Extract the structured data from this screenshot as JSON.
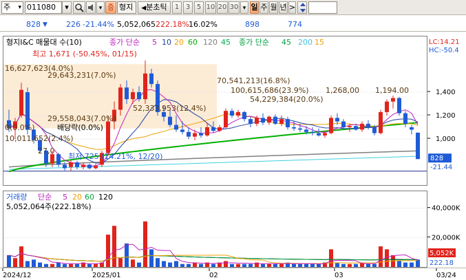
{
  "toolbar": {
    "market_label": "주",
    "stock_code": "011080",
    "mode_label": "증",
    "name_label": "형지",
    "unit_label": "분초틱",
    "periods": [
      "1",
      "3",
      "5",
      "10",
      "20",
      "30"
    ],
    "dropdown_label": "▾",
    "day_label": "일",
    "week_label": "주",
    "month_label": "월",
    "year_label": "년",
    "next_label": ">"
  },
  "infobar": {
    "price": "828",
    "change": "226",
    "change_pct": "-21.44%",
    "volume": "5,052,065",
    "volume_pct": "222.18%",
    "turnover": "16.02%",
    "val1": "898",
    "val2": "774"
  },
  "price_panel": {
    "legend_name": "형지I&C 매물대 수(10)",
    "legend_ma_prefix": "종가 단순",
    "legend_ma": [
      "5",
      "10",
      "20",
      "60",
      "120",
      "45"
    ],
    "legend_ma2_prefix": "종가 단순",
    "legend_ma2": [
      "45",
      "200",
      "15"
    ],
    "high_note": "최고 1,671 (-50.45%, 01/15)",
    "low_note": "최저 725 (14.21%, 12/20)",
    "lc_label": "LC:14.21",
    "hc_label": "HC:-50.4",
    "annotations": [
      "16,627,623(4.0%)",
      "29,643,231(7.0%)",
      "70,541,213(16.8%)",
      "100,615,686(23.9%)",
      "1,268,00",
      "1,194.00",
      "54,229,384(20.0%)",
      "52,333,953(12.4%)",
      "29,558,043(7.0%)",
      "배당락(0.0%)",
      "0(0.0%)",
      "10,011,652(2.4%)",
      "27,0"
    ],
    "axis_ticks": [
      "1,400",
      "1,200",
      "1,000"
    ],
    "current_price": "828",
    "current_change": "-21.44",
    "colors": {
      "up": "#e0231c",
      "down": "#1f5bd6",
      "ma5": "#c020c0",
      "ma20": "#f0a000",
      "ma60": "#00b000",
      "ma120": "#808080",
      "ma200": "#40d0e0"
    }
  },
  "vol_panel": {
    "legend_name": "거래량",
    "legend_prefix": "단순",
    "legend_ma": [
      "5",
      "20",
      "60",
      "120"
    ],
    "volume_note": "5,052,064주(222.18%)",
    "axis_ticks": [
      "40,000K",
      "20,000K"
    ],
    "current_volume": "5,052K",
    "current_pct": "222.18"
  },
  "date_axis": {
    "labels": [
      "2024/12",
      "2025/01",
      "02",
      "03",
      "03/24"
    ]
  },
  "chart_data": {
    "type": "candlestick",
    "ylim": [
      700,
      1700
    ],
    "dates_note": "daily candles, 2024/12 – 2025/03/24",
    "candles": [
      {
        "o": 1160,
        "h": 1250,
        "l": 1060,
        "c": 1090
      },
      {
        "o": 1090,
        "h": 1180,
        "l": 1000,
        "c": 1150
      },
      {
        "o": 1200,
        "h": 1480,
        "l": 1180,
        "c": 1420
      },
      {
        "o": 1400,
        "h": 1440,
        "l": 1040,
        "c": 1080
      },
      {
        "o": 1080,
        "h": 1100,
        "l": 960,
        "c": 990
      },
      {
        "o": 990,
        "h": 1010,
        "l": 880,
        "c": 900
      },
      {
        "o": 900,
        "h": 920,
        "l": 760,
        "c": 790
      },
      {
        "o": 790,
        "h": 900,
        "l": 760,
        "c": 870
      },
      {
        "o": 870,
        "h": 880,
        "l": 760,
        "c": 780
      },
      {
        "o": 780,
        "h": 800,
        "l": 730,
        "c": 750
      },
      {
        "o": 760,
        "h": 820,
        "l": 725,
        "c": 800
      },
      {
        "o": 800,
        "h": 815,
        "l": 740,
        "c": 760
      },
      {
        "o": 760,
        "h": 800,
        "l": 740,
        "c": 780
      },
      {
        "o": 780,
        "h": 790,
        "l": 740,
        "c": 750
      },
      {
        "o": 750,
        "h": 790,
        "l": 740,
        "c": 770
      },
      {
        "o": 780,
        "h": 900,
        "l": 760,
        "c": 880
      },
      {
        "o": 880,
        "h": 1200,
        "l": 860,
        "c": 1150
      },
      {
        "o": 1150,
        "h": 1320,
        "l": 1080,
        "c": 1250
      },
      {
        "o": 1250,
        "h": 1470,
        "l": 1200,
        "c": 1440
      },
      {
        "o": 1440,
        "h": 1500,
        "l": 1300,
        "c": 1340
      },
      {
        "o": 1340,
        "h": 1430,
        "l": 1300,
        "c": 1400
      },
      {
        "o": 1400,
        "h": 1450,
        "l": 1320,
        "c": 1340
      },
      {
        "o": 1340,
        "h": 1671,
        "l": 1300,
        "c": 1560
      },
      {
        "o": 1560,
        "h": 1600,
        "l": 1440,
        "c": 1470
      },
      {
        "o": 1470,
        "h": 1500,
        "l": 1200,
        "c": 1230
      },
      {
        "o": 1230,
        "h": 1280,
        "l": 1150,
        "c": 1190
      },
      {
        "o": 1190,
        "h": 1250,
        "l": 1100,
        "c": 1120
      },
      {
        "o": 1120,
        "h": 1200,
        "l": 1060,
        "c": 1080
      },
      {
        "o": 1080,
        "h": 1150,
        "l": 1040,
        "c": 1060
      },
      {
        "o": 1060,
        "h": 1100,
        "l": 1000,
        "c": 1020
      },
      {
        "o": 1020,
        "h": 1080,
        "l": 990,
        "c": 1050
      },
      {
        "o": 1050,
        "h": 1100,
        "l": 1010,
        "c": 1030
      },
      {
        "o": 1030,
        "h": 1140,
        "l": 1020,
        "c": 1100
      },
      {
        "o": 1100,
        "h": 1150,
        "l": 1050,
        "c": 1070
      },
      {
        "o": 1070,
        "h": 1120,
        "l": 1060,
        "c": 1100
      },
      {
        "o": 1100,
        "h": 1260,
        "l": 1090,
        "c": 1240
      },
      {
        "o": 1240,
        "h": 1260,
        "l": 1180,
        "c": 1200
      },
      {
        "o": 1200,
        "h": 1250,
        "l": 1180,
        "c": 1230
      },
      {
        "o": 1230,
        "h": 1240,
        "l": 1150,
        "c": 1170
      },
      {
        "o": 1170,
        "h": 1190,
        "l": 1100,
        "c": 1130
      },
      {
        "o": 1130,
        "h": 1200,
        "l": 1110,
        "c": 1180
      },
      {
        "o": 1180,
        "h": 1220,
        "l": 1120,
        "c": 1140
      },
      {
        "o": 1140,
        "h": 1200,
        "l": 1120,
        "c": 1190
      },
      {
        "o": 1190,
        "h": 1210,
        "l": 1120,
        "c": 1130
      },
      {
        "o": 1130,
        "h": 1200,
        "l": 1110,
        "c": 1170
      },
      {
        "o": 1170,
        "h": 1190,
        "l": 1080,
        "c": 1100
      },
      {
        "o": 1100,
        "h": 1150,
        "l": 1070,
        "c": 1090
      },
      {
        "o": 1090,
        "h": 1130,
        "l": 1060,
        "c": 1080
      },
      {
        "o": 1080,
        "h": 1110,
        "l": 1040,
        "c": 1060
      },
      {
        "o": 1060,
        "h": 1100,
        "l": 1030,
        "c": 1050
      },
      {
        "o": 1050,
        "h": 1090,
        "l": 1020,
        "c": 1030
      },
      {
        "o": 1030,
        "h": 1070,
        "l": 1010,
        "c": 1050
      },
      {
        "o": 1050,
        "h": 1200,
        "l": 1040,
        "c": 1180
      },
      {
        "o": 1180,
        "h": 1220,
        "l": 1120,
        "c": 1150
      },
      {
        "o": 1150,
        "h": 1170,
        "l": 1080,
        "c": 1100
      },
      {
        "o": 1100,
        "h": 1130,
        "l": 1060,
        "c": 1110
      },
      {
        "o": 1110,
        "h": 1130,
        "l": 1070,
        "c": 1080
      },
      {
        "o": 1080,
        "h": 1150,
        "l": 1060,
        "c": 1130
      },
      {
        "o": 1130,
        "h": 1160,
        "l": 1080,
        "c": 1100
      },
      {
        "o": 1100,
        "h": 1120,
        "l": 1030,
        "c": 1050
      },
      {
        "o": 1050,
        "h": 1250,
        "l": 1040,
        "c": 1230
      },
      {
        "o": 1230,
        "h": 1340,
        "l": 1200,
        "c": 1320
      },
      {
        "o": 1320,
        "h": 1370,
        "l": 1260,
        "c": 1350
      },
      {
        "o": 1350,
        "h": 1360,
        "l": 1200,
        "c": 1220
      },
      {
        "o": 1220,
        "h": 1240,
        "l": 1100,
        "c": 1130
      },
      {
        "o": 1100,
        "h": 1120,
        "l": 1040,
        "c": 1080
      },
      {
        "o": 1054,
        "h": 1054,
        "l": 828,
        "c": 828
      }
    ],
    "volumes": [
      8,
      6,
      14,
      4,
      5,
      3,
      2,
      2,
      3,
      2,
      2,
      2,
      3,
      2,
      2,
      3,
      22,
      28,
      6,
      16,
      5,
      3,
      31,
      12,
      6,
      4,
      3,
      4,
      2,
      2,
      3,
      2,
      3,
      2,
      3,
      4,
      2,
      2,
      2,
      2,
      3,
      2,
      2,
      2,
      2,
      3,
      2,
      2,
      2,
      2,
      2,
      3,
      12,
      3,
      2,
      2,
      2,
      3,
      2,
      2,
      14,
      12,
      8,
      4,
      3,
      3,
      5
    ],
    "vol_ylim": [
      0,
      45
    ]
  }
}
